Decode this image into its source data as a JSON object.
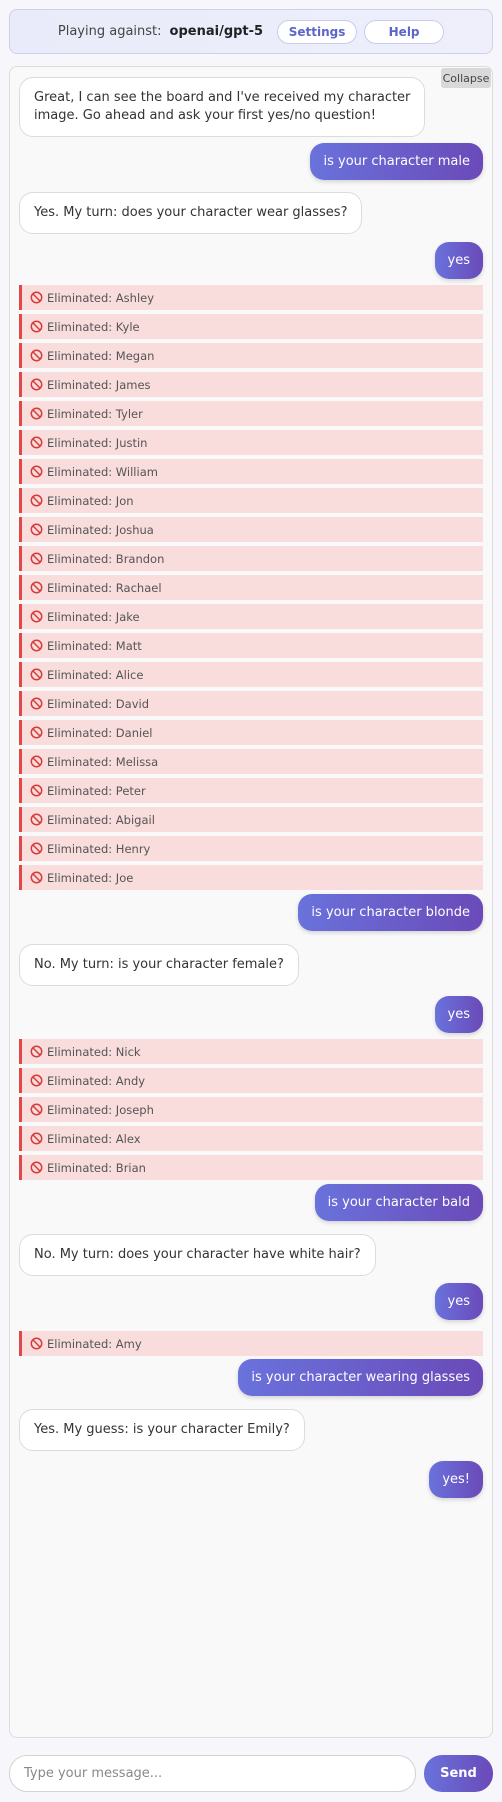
{
  "header": {
    "playing_label": "Playing against:",
    "model": "openai/gpt-5",
    "settings_label": "Settings",
    "help_label": "Help"
  },
  "chat": {
    "collapse_label": "Collapse",
    "messages": [
      {
        "role": "ai",
        "lines": [
          "Great, I can see the board and I've received my character",
          "image. Go ahead and ask your first yes/no question!"
        ]
      },
      {
        "role": "user",
        "text": "is your character male"
      },
      {
        "role": "ai",
        "lines": [
          "Yes. My turn: does your character wear glasses?"
        ]
      },
      {
        "role": "user",
        "text": "yes"
      },
      {
        "role": "elim",
        "text": "Eliminated: Ashley"
      },
      {
        "role": "elim",
        "text": "Eliminated: Kyle"
      },
      {
        "role": "elim",
        "text": "Eliminated: Megan"
      },
      {
        "role": "elim",
        "text": "Eliminated: James"
      },
      {
        "role": "elim",
        "text": "Eliminated: Tyler"
      },
      {
        "role": "elim",
        "text": "Eliminated: Justin"
      },
      {
        "role": "elim",
        "text": "Eliminated: William"
      },
      {
        "role": "elim",
        "text": "Eliminated: Jon"
      },
      {
        "role": "elim",
        "text": "Eliminated: Joshua"
      },
      {
        "role": "elim",
        "text": "Eliminated: Brandon"
      },
      {
        "role": "elim",
        "text": "Eliminated: Rachael"
      },
      {
        "role": "elim",
        "text": "Eliminated: Jake"
      },
      {
        "role": "elim",
        "text": "Eliminated: Matt"
      },
      {
        "role": "elim",
        "text": "Eliminated: Alice"
      },
      {
        "role": "elim",
        "text": "Eliminated: David"
      },
      {
        "role": "elim",
        "text": "Eliminated: Daniel"
      },
      {
        "role": "elim",
        "text": "Eliminated: Melissa"
      },
      {
        "role": "elim",
        "text": "Eliminated: Peter"
      },
      {
        "role": "elim",
        "text": "Eliminated: Abigail"
      },
      {
        "role": "elim",
        "text": "Eliminated: Henry"
      },
      {
        "role": "elim",
        "text": "Eliminated: Joe"
      },
      {
        "role": "user",
        "text": "is your character blonde"
      },
      {
        "role": "ai",
        "lines": [
          "No. My turn: is your character female?"
        ]
      },
      {
        "role": "user",
        "text": "yes"
      },
      {
        "role": "elim",
        "text": "Eliminated: Nick"
      },
      {
        "role": "elim",
        "text": "Eliminated: Andy"
      },
      {
        "role": "elim",
        "text": "Eliminated: Joseph"
      },
      {
        "role": "elim",
        "text": "Eliminated: Alex"
      },
      {
        "role": "elim",
        "text": "Eliminated: Brian"
      },
      {
        "role": "user",
        "text": "is your character bald"
      },
      {
        "role": "ai",
        "lines": [
          "No. My turn: does your character have white hair?"
        ]
      },
      {
        "role": "user",
        "text": "yes"
      },
      {
        "role": "elim",
        "text": "Eliminated: Amy"
      },
      {
        "role": "user",
        "text": "is your character wearing glasses"
      },
      {
        "role": "ai",
        "lines": [
          "Yes. My guess: is your character Emily?"
        ]
      },
      {
        "role": "user",
        "text": "yes!"
      }
    ]
  },
  "input": {
    "placeholder": "Type your message...",
    "value": "",
    "send_label": "Send"
  },
  "icons": {
    "eliminated": "prohibited-icon"
  },
  "colors": {
    "accent_start": "#6a72dc",
    "accent_end": "#6a4ab8",
    "eliminated_bg": "#f9dcdc",
    "eliminated_border": "#e04848"
  }
}
